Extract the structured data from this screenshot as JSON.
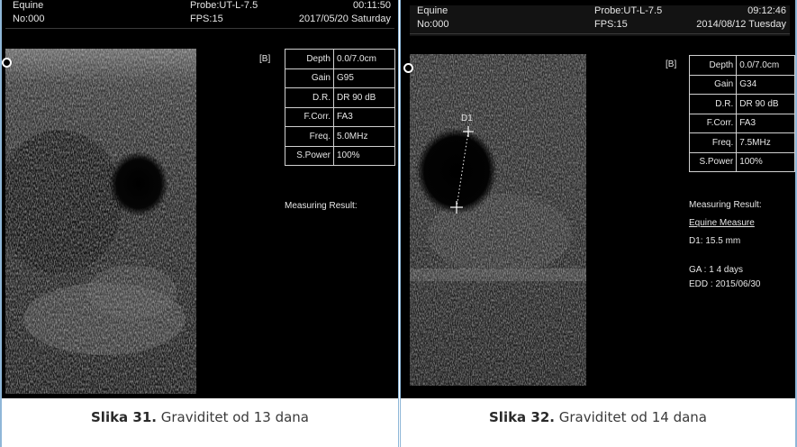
{
  "panels": [
    {
      "header": {
        "patient": "Equine",
        "probe": "Probe:UT-L-7.5",
        "time": "00:11:50",
        "number": "No:000",
        "fps": "FPS:15",
        "date": "2017/05/20 Saturday"
      },
      "mode": "[B]",
      "params": [
        {
          "key": "Depth",
          "value": "0.0/7.0cm"
        },
        {
          "key": "Gain",
          "value": "G95"
        },
        {
          "key": "D.R.",
          "value": "DR 90 dB"
        },
        {
          "key": "F.Corr.",
          "value": "FA3"
        },
        {
          "key": "Freq.",
          "value": "5.0MHz"
        },
        {
          "key": "S.Power",
          "value": "100%"
        }
      ],
      "measuring_title": "Measuring Result:",
      "caption": {
        "label": "Slika 31.",
        "text": "Graviditet od 13 dana"
      }
    },
    {
      "header": {
        "patient": "Equine",
        "probe": "Probe:UT-L-7.5",
        "time": "09:12:46",
        "number": "No:000",
        "fps": "FPS:15",
        "date": "2014/08/12 Tuesday"
      },
      "mode": "[B]",
      "params": [
        {
          "key": "Depth",
          "value": "0.0/7.0cm"
        },
        {
          "key": "Gain",
          "value": "G34"
        },
        {
          "key": "D.R.",
          "value": "DR 90 dB"
        },
        {
          "key": "F.Corr.",
          "value": "FA3"
        },
        {
          "key": "Freq.",
          "value": "7.5MHz"
        },
        {
          "key": "S.Power",
          "value": "100%"
        }
      ],
      "measuring_title": "Measuring Result:",
      "measure_name": "Equine Measure",
      "d1": "D1: 15.5 mm",
      "ga": "GA : 1 4 days",
      "edd": "EDD : 2015/06/30",
      "caliper_label": "D1",
      "caption": {
        "label": "Slika 32.",
        "text": "Graviditet od 14 dana"
      }
    }
  ],
  "colors": {
    "screen": "#000000",
    "frame": "#8fb7d8",
    "text": "#e6e6e6"
  }
}
